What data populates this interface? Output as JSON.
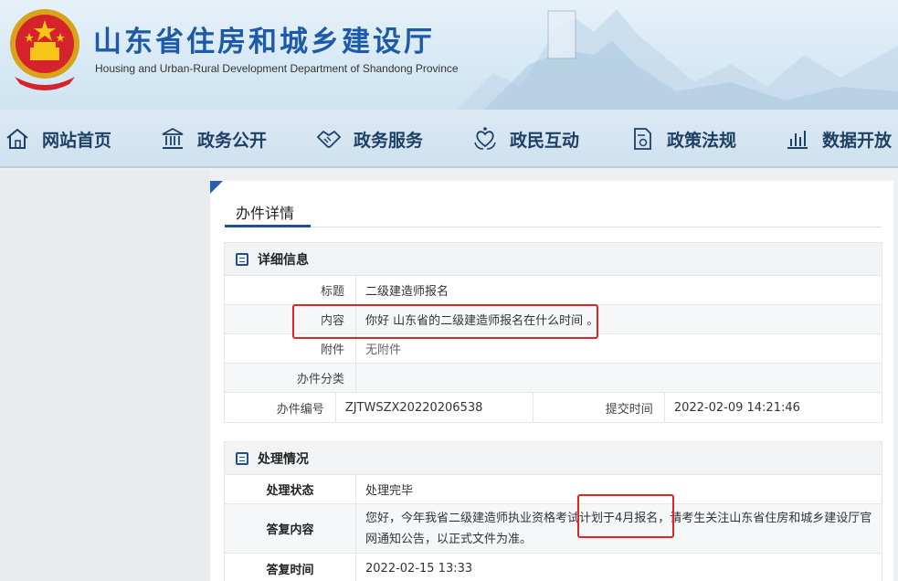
{
  "header": {
    "title": "山东省住房和城乡建设厅",
    "subtitle": "Housing and Urban-Rural Development Department of Shandong Province"
  },
  "nav": [
    {
      "label": "网站首页",
      "icon": "home-icon"
    },
    {
      "label": "政务公开",
      "icon": "building-icon"
    },
    {
      "label": "政务服务",
      "icon": "handshake-icon"
    },
    {
      "label": "政民互动",
      "icon": "heart-hands-icon"
    },
    {
      "label": "政策法规",
      "icon": "document-icon"
    },
    {
      "label": "数据开放",
      "icon": "bar-chart-icon"
    }
  ],
  "card": {
    "title": "办件详情"
  },
  "details": {
    "heading": "详细信息",
    "title_label": "标题",
    "title_value": "二级建造师报名",
    "content_label": "内容",
    "content_value": "你好 山东省的二级建造师报名在什么时间 。",
    "attachment_label": "附件",
    "attachment_value": "无附件",
    "category_label": "办件分类",
    "category_value": "",
    "number_label": "办件编号",
    "number_value": "ZJTWSZX20220206538",
    "submit_label": "提交时间",
    "submit_value": "2022-02-09 14:21:46"
  },
  "handling": {
    "heading": "处理情况",
    "status_label": "处理状态",
    "status_value": "处理完毕",
    "reply_label": "答复内容",
    "reply_value": "您好，今年我省二级建造师执业资格考试计划于4月报名，请考生关注山东省住房和城乡建设厅官网通知公告，以正式文件为准。",
    "reply_time_label": "答复时间",
    "reply_time_value": "2022-02-15 13:33"
  },
  "colors": {
    "brand_blue": "#1d5aa8",
    "nav_text": "#1e3f66",
    "highlight_red": "#e02424"
  }
}
